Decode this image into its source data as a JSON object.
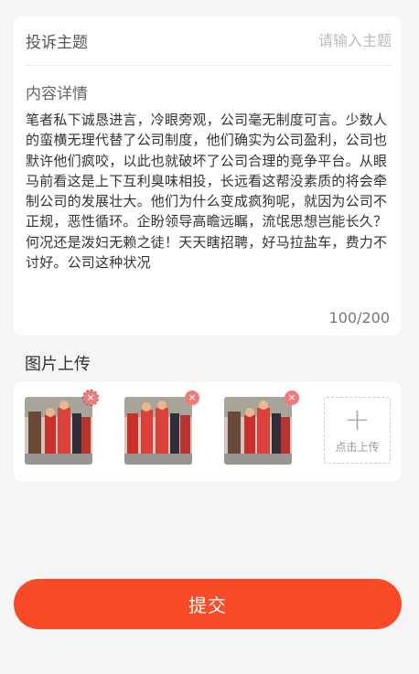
{
  "form": {
    "subject_label": "投诉主题",
    "subject_placeholder": "请输入主题",
    "subject_value": "",
    "content_label": "内容详情",
    "content_value": "笔者私下诚恳进言，冷眼旁观，公司毫无制度可言。少数人的蛮横无理代替了公司制度，他们确实为公司盈利，公司也默许他们疯咬，以此也就破坏了公司合理的竞争平台。从眼马前看这是上下互利臭味相投，长远看这帮没素质的将会牵制公司的发展壮大。他们为什么变成疯狗呢，就因为公司不正规，恶性循环。企盼领导高瞻远瞩，流氓思想岂能长久？何况还是泼妇无赖之徒！天天瞎招聘，好马拉盐车，费力不讨好。公司这种状况",
    "counter": "100/200"
  },
  "upload": {
    "section_title": "图片上传",
    "add_label": "点击上传",
    "remove_icon": "×",
    "add_icon": "+",
    "image_count": 3
  },
  "submit_label": "提交",
  "colors": {
    "accent": "#f84a26",
    "remove_badge": "#f07a7a",
    "background": "#f5f5f5"
  }
}
